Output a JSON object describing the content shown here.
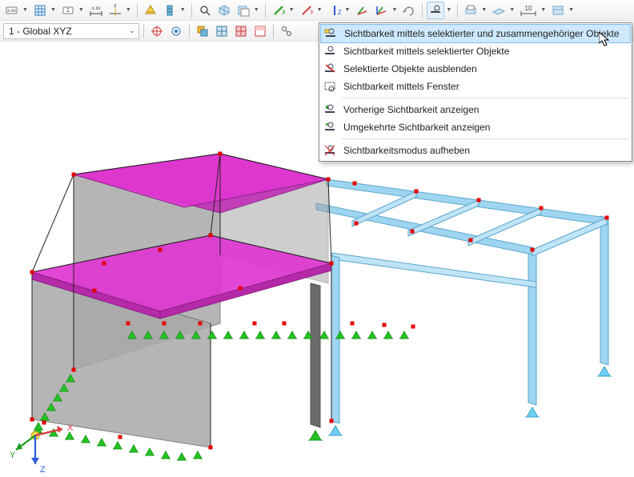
{
  "toolbar1": {
    "icons": [
      "xxx-tag-icon",
      "grid-icon",
      "number-tag-icon",
      "ruler-xxx-icon",
      "ruler-z-icon",
      "fe-surface-icon",
      "fe-member-icon",
      "zoom-icon",
      "isometric-icon",
      "section-icon",
      "ucs-x-icon",
      "ucs-y-icon",
      "ucs-z-icon",
      "ucs-xy-icon",
      "ucs-neg-icon",
      "ucs-flip-icon",
      "visibility-mode-icon",
      "view-icon",
      "plane-icon",
      "scale-10-icon",
      "table-icon"
    ],
    "scale_text": "10"
  },
  "toolbar2": {
    "select_label": "1 - Global XYZ",
    "icons": [
      "target1-icon",
      "target2-icon",
      "overlay-icon",
      "grid-blue-icon",
      "grid-red-b-icon",
      "grid-red-a-icon",
      "tool-icon"
    ]
  },
  "menu": {
    "items": [
      {
        "icon": "visibility-related-icon",
        "label": "Sichtbarkeit mittels selektierter und zusammengehöriger Objekte",
        "highlighted": true
      },
      {
        "icon": "visibility-selected-icon",
        "label": "Sichtbarkeit mittels selektierter Objekte"
      },
      {
        "icon": "hide-selected-icon",
        "label": "Selektierte Objekte ausblenden"
      },
      {
        "icon": "visibility-window-icon",
        "label": "Sichtbarkeit mittels Fenster"
      },
      {
        "sep": true
      },
      {
        "icon": "visibility-prev-icon",
        "label": "Vorherige Sichtbarkeit anzeigen"
      },
      {
        "icon": "visibility-invert-icon",
        "label": "Umgekehrte Sichtbarkeit anzeigen"
      },
      {
        "sep": true
      },
      {
        "icon": "visibility-clear-icon",
        "label": "Sichtbarkeitsmodus aufheben"
      }
    ]
  },
  "axis": {
    "x": "X",
    "y": "Y",
    "z": "Z"
  },
  "colors": {
    "mag_top": "#e037d2",
    "mag_side": "#a7259b",
    "wall": "#9e9e9e",
    "wall_edge": "#6d6d6d",
    "col": "#6a6a6a",
    "steel": "#9ed5f1",
    "steel_dark": "#6fb5d9",
    "node": "#e40000",
    "support": "#25c425",
    "accent": "#3f9fe0"
  }
}
